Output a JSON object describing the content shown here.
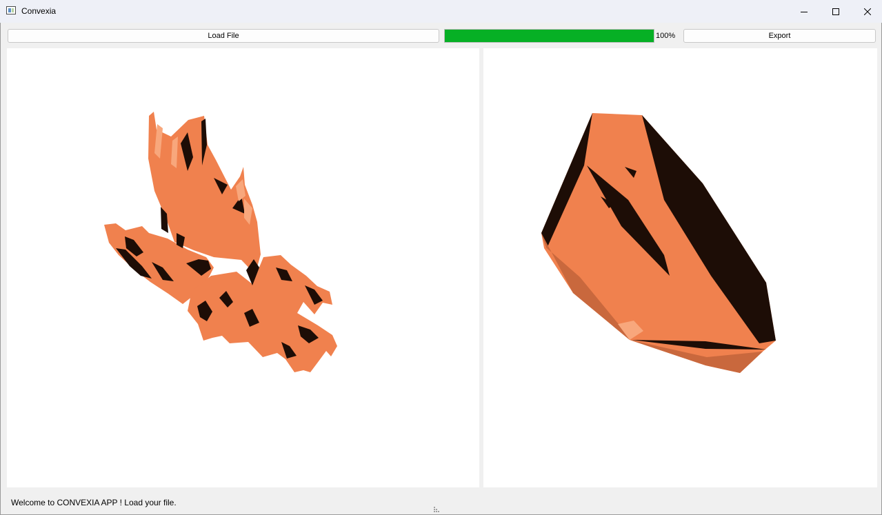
{
  "window": {
    "title": "Convexia"
  },
  "toolbar": {
    "load_label": "Load File",
    "export_label": "Export",
    "progress": {
      "value": 100,
      "label": "100%"
    }
  },
  "colors": {
    "model": "#f0814e",
    "model_dark": "#1d0d06",
    "progress": "#06b025"
  },
  "views": {
    "left": "original mesh (dragon)",
    "right": "convex hull"
  },
  "status": {
    "message": "Welcome to CONVEXIA APP ! Load your file."
  }
}
